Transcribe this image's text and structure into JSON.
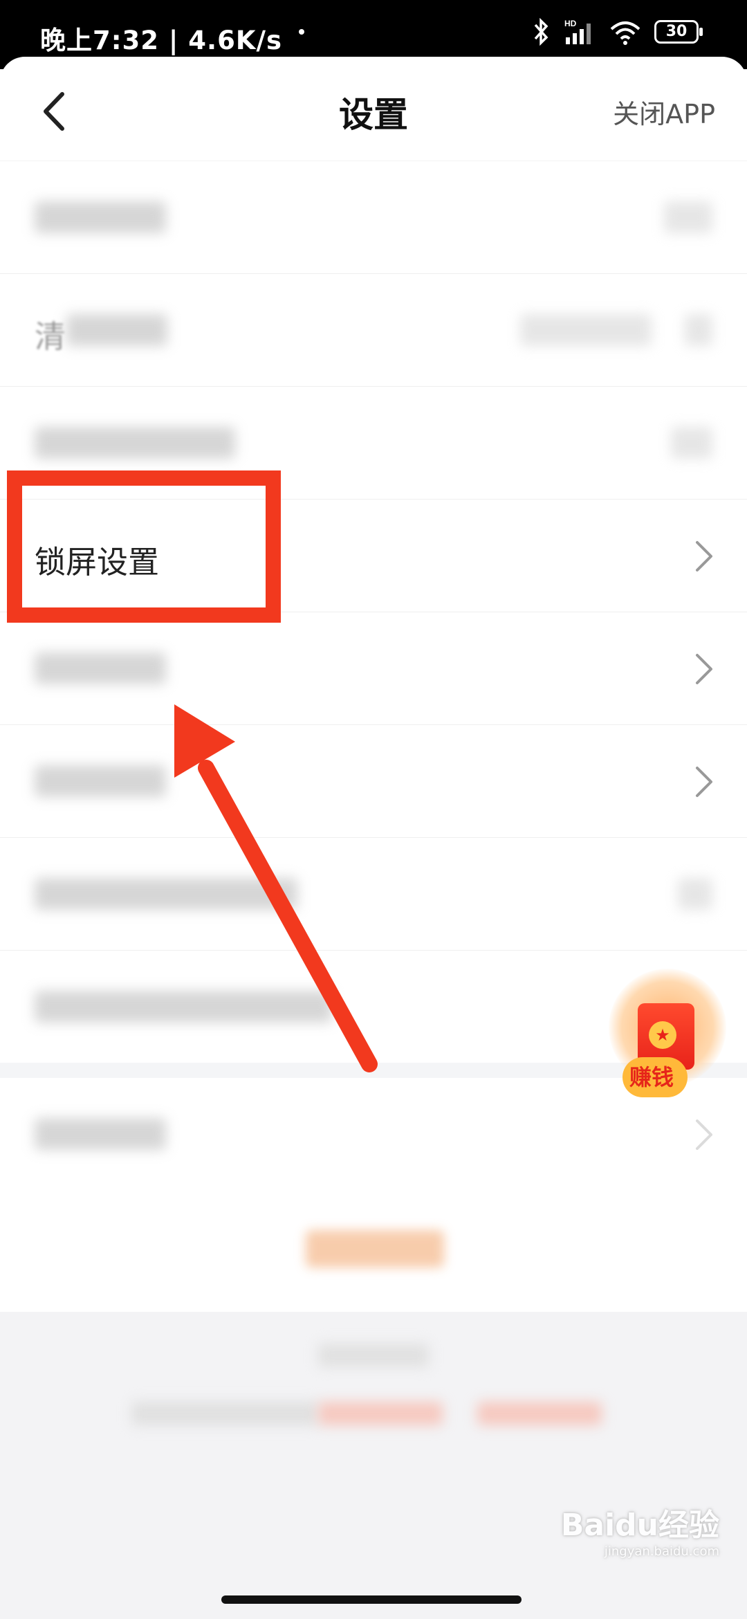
{
  "status_bar": {
    "time_speed": "晚上7:32 | 4.6K/s",
    "battery": "30"
  },
  "header": {
    "title": "设置",
    "close_app": "关闭APP"
  },
  "rows": [
    {
      "label": "",
      "blurred": true
    },
    {
      "label": "清",
      "blurred": true
    },
    {
      "label": "",
      "blurred": true
    },
    {
      "label": "锁屏设置",
      "blurred": false
    },
    {
      "label": "",
      "blurred": true
    },
    {
      "label": "",
      "blurred": true
    },
    {
      "label": "",
      "blurred": true
    },
    {
      "label": "",
      "blurred": true
    },
    {
      "label": "",
      "blurred": true
    }
  ],
  "floating_widget": {
    "label": "赚钱",
    "coin_icon": "star-icon"
  },
  "annotation": {
    "highlight_color": "#f2391e"
  },
  "watermark": {
    "brand": "Baidu经验",
    "url": "jingyan.baidu.com"
  }
}
